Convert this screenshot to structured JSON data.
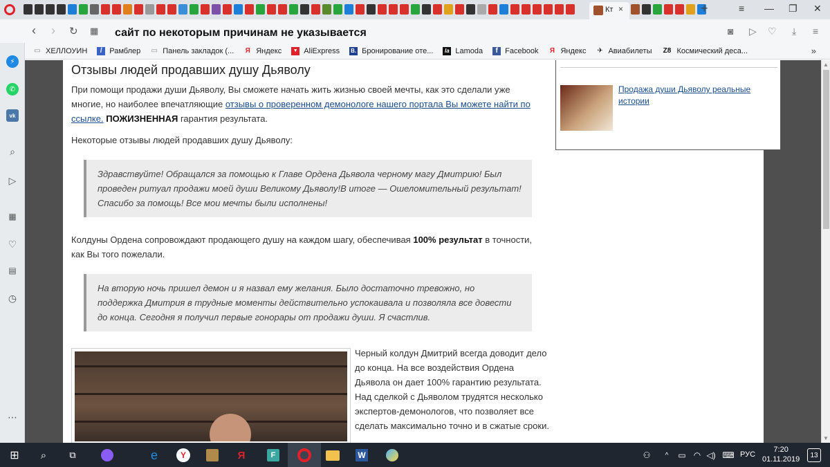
{
  "browser": {
    "active_tab_title": "Кт",
    "address": "сайт по некоторым причинам не указывается",
    "tab_icon_colors": [
      "#333",
      "#333",
      "#333",
      "#333",
      "#1d7fd8",
      "#29a53d",
      "#666",
      "#d8302a",
      "#d8302a",
      "#e07f1c",
      "#d8302a",
      "#999",
      "#d8302a",
      "#d8302a",
      "#3a8fd8",
      "#29a53d",
      "#d8302a",
      "#7b52a8",
      "#d8302a",
      "#1d7fd8",
      "#d8302a",
      "#29a53d",
      "#d8302a",
      "#d8302a",
      "#29a53d",
      "#333",
      "#d8302a",
      "#5a8a2e",
      "#29a53d",
      "#1d7fd8",
      "#d8302a",
      "#333",
      "#d8302a",
      "#d8302a",
      "#d8302a",
      "#29a53d",
      "#333",
      "#d8302a",
      "#e0a21c",
      "#d8302a",
      "#333",
      "#aaa",
      "#d8302a",
      "#1d7fd8",
      "#d8302a",
      "#d8302a",
      "#d8302a",
      "#d8302a",
      "#d8302a",
      "#d8302a",
      "#d8302a",
      "#d8302a",
      "#d8302a",
      "#1d7fd8",
      "#a0522d"
    ]
  },
  "bookmarks": [
    {
      "label": "ХЕЛЛОУИН",
      "icon": "folder-icon",
      "color": "#888"
    },
    {
      "label": "Рамблер",
      "icon": "rambler-icon",
      "color": "#3a63c8"
    },
    {
      "label": "Панель закладок (...",
      "icon": "folder-icon",
      "color": "#888"
    },
    {
      "label": "Яндекс",
      "icon": "yandex-icon",
      "color": "#e0212a"
    },
    {
      "label": "AliExpress",
      "icon": "aliexpress-icon",
      "color": "#e0212a"
    },
    {
      "label": "Бронирование оте...",
      "icon": "booking-icon",
      "color": "#1f3f8f"
    },
    {
      "label": "Lamoda",
      "icon": "lamoda-icon",
      "color": "#111"
    },
    {
      "label": "Facebook",
      "icon": "facebook-icon",
      "color": "#3b5998"
    },
    {
      "label": "Яндекс",
      "icon": "yandex-icon",
      "color": "#e0212a"
    },
    {
      "label": "Авиабилеты",
      "icon": "plane-icon",
      "color": "#222"
    },
    {
      "label": "Космический деса...",
      "icon": "z8-icon",
      "color": "#111"
    }
  ],
  "bookmark_glyphs": {
    "b0": "▭",
    "b1": "/",
    "b2": "▭",
    "b3": "Я",
    "b4": "▼",
    "b5": "B.",
    "b6": "la",
    "b7": "f",
    "b8": "Я",
    "b9": "✈",
    "b10": "Z8"
  },
  "article": {
    "heading": "Отзывы людей продавших душу Дьяволу",
    "p1_start": "При помощи продажи души Дьяволу, Вы сможете начать жить жизнью своей мечты, как это сделали уже многие, но наиболее впечатляющие ",
    "p1_link": "отзывы о проверенном демонологе нашего портала Вы можете найти по ссылке.",
    "p1_bold": "ПОЖИЗНЕННАЯ",
    "p1_end": " гарантия результата.",
    "p2": "Некоторые отзывы людей продавших душу Дьяволу:",
    "quote1": "Здравствуйте! Обращался за помощью к Главе Ордена Дьявола черному магу Дмитрию! Был проведен ритуал продажи моей души Великому Дьяволу!В итоге — Ошеломительный результат! Спасибо за помощь! Все мои мечты были исполнены!",
    "p3_start": "Колдуны Ордена сопровождают продающего душу на каждом шагу, обеспечивая ",
    "p3_bold": "100% результат",
    "p3_end": " в точности, как Вы того пожелали.",
    "quote2": "На вторую ночь пришел демон и я назвал ему желания. Было достаточно тревожно, но поддержка Дмитрия в трудные моменты действительно успокаивала и позволяла все довести до конца. Сегодня я получил первые гонорары от продажи души. Я счастлив.",
    "photo_text": "Черный колдун Дмитрий всегда доводит дело до конца. На все воздействия Ордена Дьявола он дает 100% гарантию результата. Над сделкой с Дьяволом трудятся несколько экспертов-демонологов, что позволяет все сделать максимально точно и в сжатые сроки."
  },
  "sidebar_widget": {
    "link": "Продажа души Дьяволу реальные истории"
  },
  "taskbar": {
    "lang": "РУС",
    "time": "7:20",
    "date": "01.11.2019",
    "notifications": "13"
  }
}
